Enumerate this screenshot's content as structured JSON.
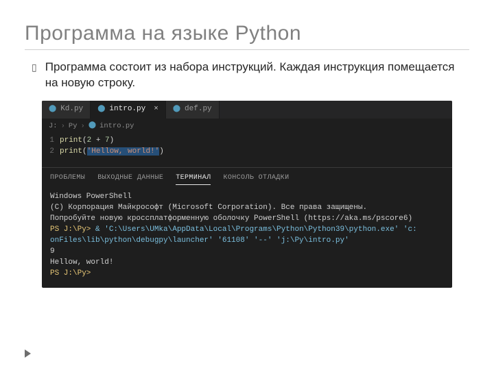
{
  "slide": {
    "title": "Программа на языке Python",
    "bullet": "Программа состоит из набора инструкций. Каждая инструкция помещается на новую строку."
  },
  "editor": {
    "tabs": [
      {
        "icon": "python-file-icon",
        "label": "Kd.py",
        "active": false,
        "closable": false
      },
      {
        "icon": "python-file-icon",
        "label": "intro.py",
        "active": true,
        "closable": true
      },
      {
        "icon": "python-file-icon",
        "label": "def.py",
        "active": false,
        "closable": false
      }
    ],
    "breadcrumbs": {
      "drive": "J:",
      "folder": "Py",
      "file": "intro.py"
    },
    "code": {
      "line1": {
        "no": "1",
        "fn": "print",
        "open": "(",
        "a": "2",
        "op": " + ",
        "b": "7",
        "close": ")"
      },
      "line2": {
        "no": "2",
        "fn": "print",
        "open": "(",
        "str": "'Hellow, world!'",
        "close": ")"
      }
    }
  },
  "panel": {
    "tabs": {
      "problems": "ПРОБЛЕМЫ",
      "output": "ВЫХОДНЫЕ ДАННЫЕ",
      "terminal": "ТЕРМИНАЛ",
      "debug": "КОНСОЛЬ ОТЛАДКИ"
    },
    "terminal": {
      "l1": "Windows PowerShell",
      "l2": "(C) Корпорация Майкрософт (Microsoft Corporation). Все права защищены.",
      "l3": "",
      "l4": "Попробуйте новую кроссплатформенную оболочку PowerShell (https://aka.ms/pscore6)",
      "l5": "",
      "prompt1_path": "PS J:\\Py> ",
      "cmd_part1": "& 'C:\\Users\\UMka\\AppData\\Local\\Programs\\Python\\Python39\\python.exe' 'c:",
      "cmd_part2": "onFiles\\lib\\python\\debugpy\\launcher' '61108' '--' 'j:\\Py\\intro.py'",
      "out1": "9",
      "out2": "Hellow, world!",
      "prompt2_path": "PS J:\\Py>"
    }
  }
}
